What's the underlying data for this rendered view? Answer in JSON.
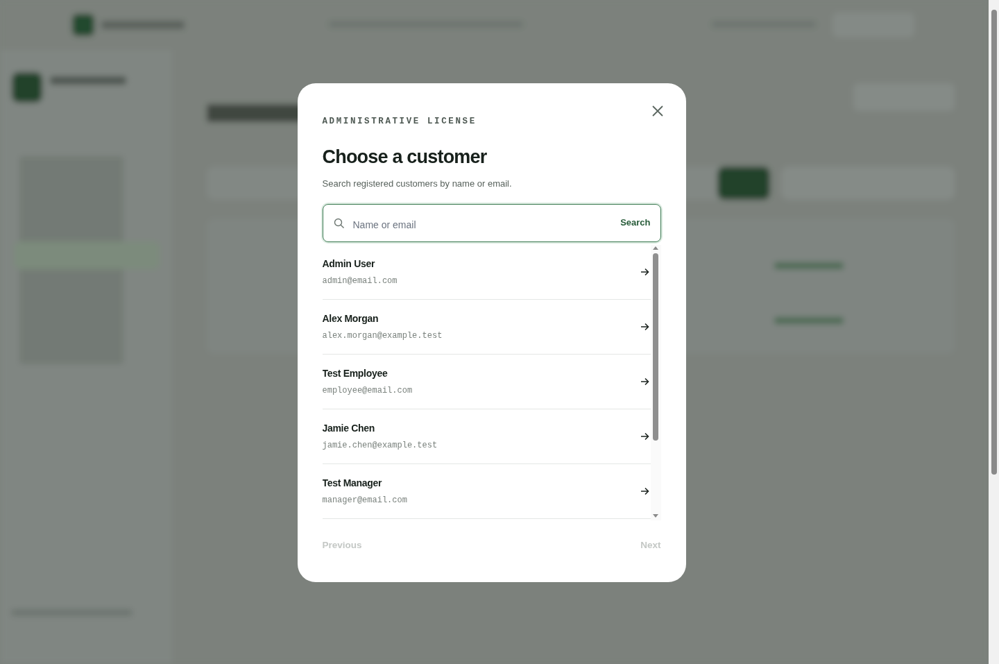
{
  "dialog": {
    "eyebrow": "ADMINISTRATIVE LICENSE",
    "title": "Choose a customer",
    "description": "Search registered customers by name or email.",
    "search": {
      "placeholder": "Name or email",
      "button": "Search"
    },
    "customers": [
      {
        "name": "Admin User",
        "email": "admin@email.com"
      },
      {
        "name": "Alex Morgan",
        "email": "alex.morgan@example.test"
      },
      {
        "name": "Test Employee",
        "email": "employee@email.com"
      },
      {
        "name": "Jamie Chen",
        "email": "jamie.chen@example.test"
      },
      {
        "name": "Test Manager",
        "email": "manager@email.com"
      }
    ],
    "pagination": {
      "previous": {
        "label": "Previous",
        "disabled": true
      },
      "next": {
        "label": "Next",
        "disabled": true
      }
    }
  }
}
